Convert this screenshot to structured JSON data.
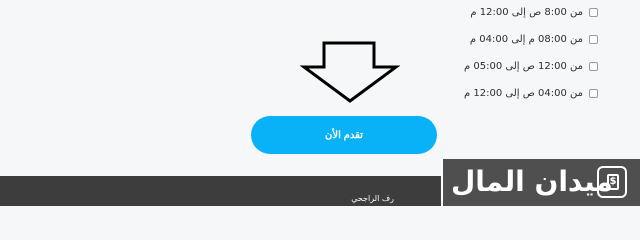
{
  "shift_options": [
    {
      "label": "من 8:00 ص إلى 12:00 م"
    },
    {
      "label": "من 08:00 م إلى 04:00 م"
    },
    {
      "label": "من 12:00 ص إلى 05:00 م"
    },
    {
      "label": "من 04:00 ص إلى 12:00 م"
    }
  ],
  "apply_button": {
    "label": "تقدم الأن"
  },
  "footer": {
    "text": "رف الراجحي"
  },
  "brand": {
    "name": "ميدان المال",
    "icon_glyph": "$"
  },
  "colors": {
    "accent": "#09b2f6",
    "footer_bg": "#3d3d3d",
    "logo_bg": "#4f4f4f",
    "page_bg": "#f6f7f9"
  }
}
